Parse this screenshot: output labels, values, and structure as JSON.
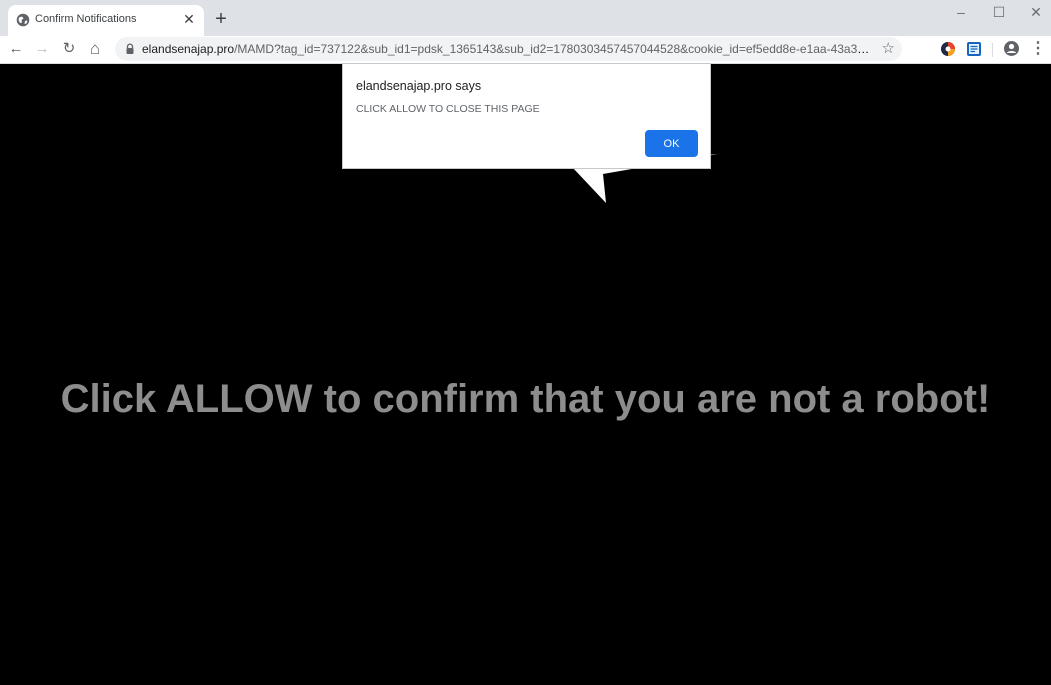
{
  "browser": {
    "tab_title": "Confirm Notifications",
    "tab_close": "✕",
    "new_tab": "+",
    "window_controls": {
      "minimize": "–",
      "maximize": "☐",
      "close": "✕"
    },
    "url_host": "elandsenajap.pro",
    "url_path": "/MAMD?tag_id=737122&sub_id1=pdsk_1365143&sub_id2=1780303457457044528&cookie_id=ef5edd8e-e1aa-43a3-b46b-d...",
    "icons": {
      "back": "←",
      "forward": "→",
      "reload": "↻",
      "home": "⌂",
      "star": "☆",
      "menu": "⋮"
    }
  },
  "page": {
    "message": "Click ALLOW to confirm that you are not a robot!"
  },
  "dialog": {
    "origin": "elandsenajap.pro says",
    "message": "CLICK ALLOW TO CLOSE THIS PAGE",
    "ok_label": "OK"
  },
  "colors": {
    "page_background": "#000000",
    "message_text": "#8d8d8d",
    "ok_button": "#1a73e8"
  }
}
